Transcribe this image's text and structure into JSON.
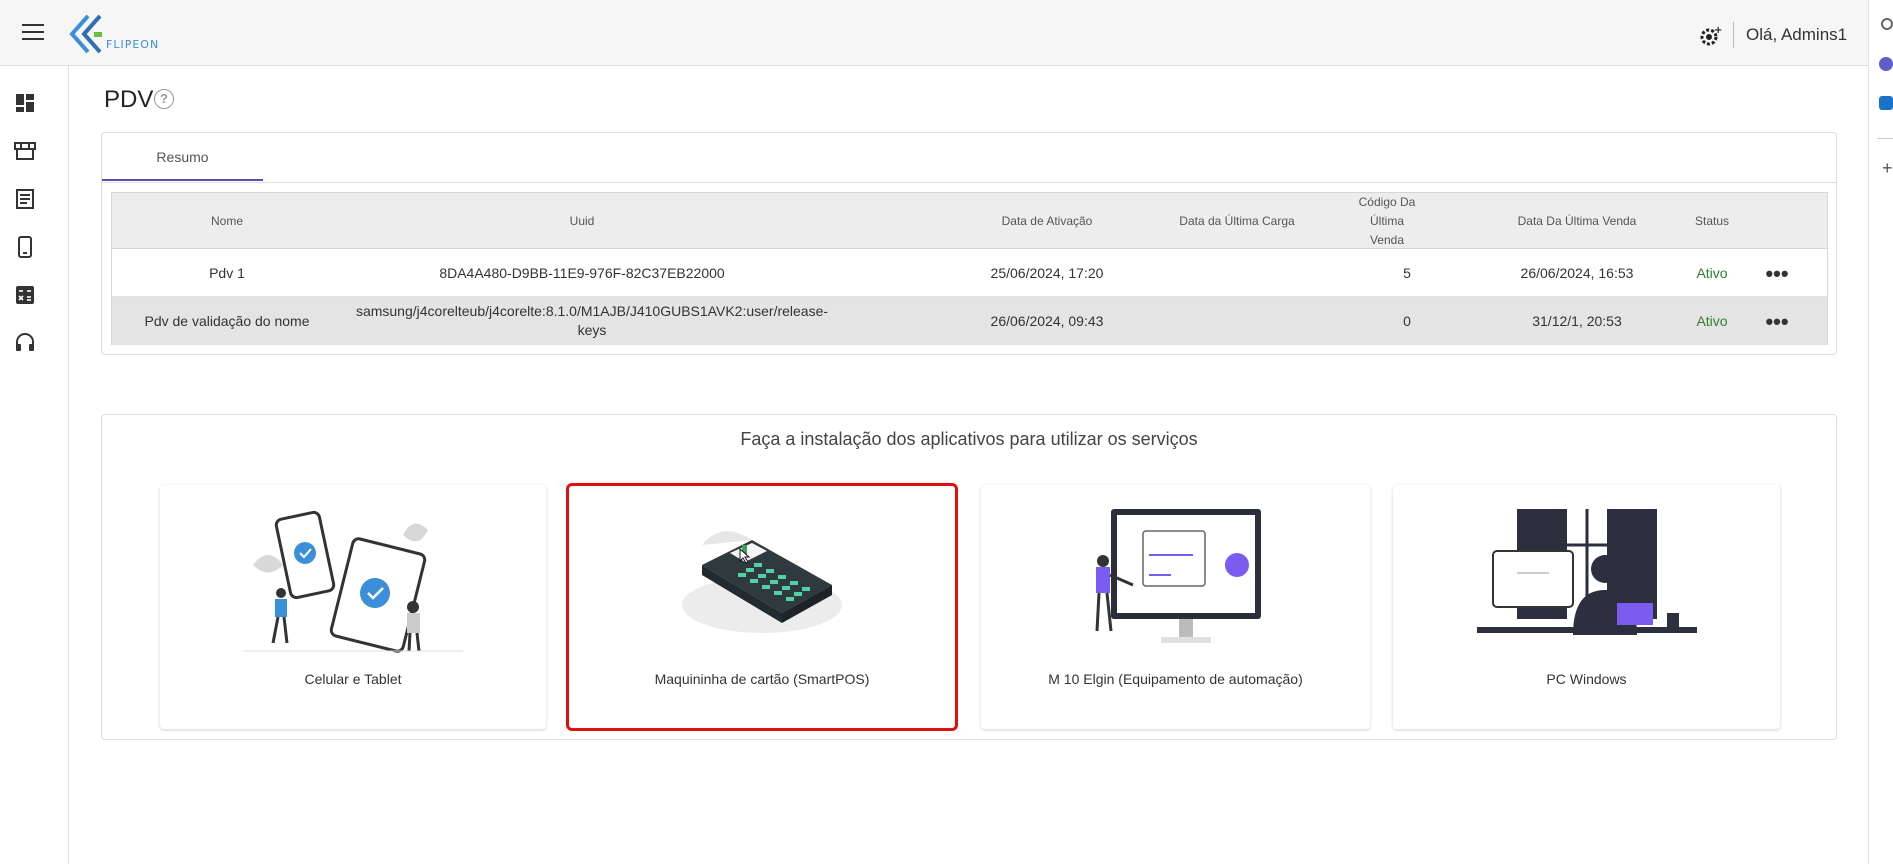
{
  "header": {
    "logo_text": "FLIPEON",
    "greeting": "Olá, Admins1",
    "settings_icon": "gear-icon"
  },
  "sidebar": {
    "items": [
      {
        "icon": "dashboard-icon"
      },
      {
        "icon": "store-icon"
      },
      {
        "icon": "receipt-icon"
      },
      {
        "icon": "phone-icon"
      },
      {
        "icon": "calculator-icon"
      },
      {
        "icon": "headset-icon"
      }
    ]
  },
  "page": {
    "title": "PDV"
  },
  "summary": {
    "tab_label": "Resumo",
    "columns": [
      "Nome",
      "Uuid",
      "Data de Ativação",
      "Data da Última Carga",
      "Código Da Última Venda",
      "Data Da Última Venda",
      "Status"
    ],
    "rows": [
      {
        "nome": "Pdv 1",
        "uuid": "8DA4A480-D9BB-11E9-976F-82C37EB22000",
        "ativacao": "25/06/2024, 17:20",
        "ultima_carga": "",
        "codigo_venda": "5",
        "data_venda": "26/06/2024, 16:53",
        "status": "Ativo"
      },
      {
        "nome": "Pdv de validação do nome",
        "uuid": "samsung/j4corelteub/j4corelte:8.1.0/M1AJB/J410GUBS1AVK2:user/release-keys",
        "ativacao": "26/06/2024, 09:43",
        "ultima_carga": "",
        "codigo_venda": "0",
        "data_venda": "31/12/1, 20:53",
        "status": "Ativo"
      }
    ]
  },
  "install": {
    "title": "Faça a instalação dos aplicativos para utilizar os serviços",
    "apps": [
      {
        "label": "Celular e Tablet"
      },
      {
        "label": "Maquininha de cartão (SmartPOS)"
      },
      {
        "label": "M 10 Elgin (Equipamento de automação)"
      },
      {
        "label": "PC Windows"
      }
    ]
  },
  "colors": {
    "accent": "#5a4fb0",
    "status_active": "#2e7d32",
    "highlight": "#e01010",
    "illustration_blue": "#3b8fd8",
    "illustration_purple": "#7b5cf0"
  }
}
